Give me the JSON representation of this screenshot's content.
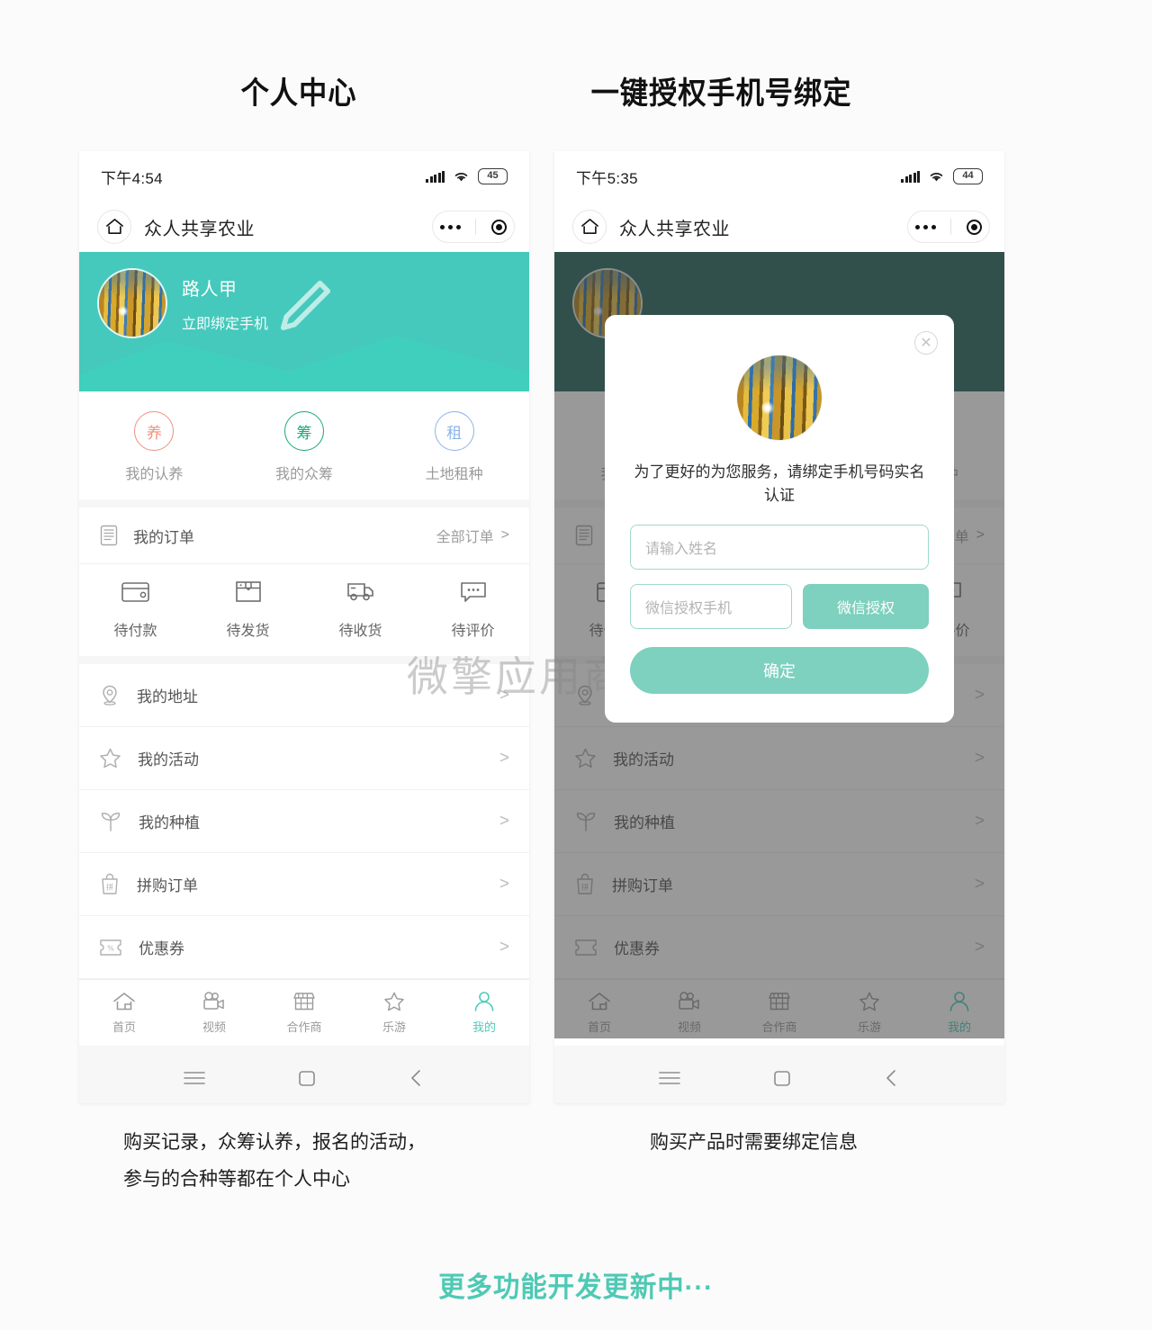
{
  "titles": {
    "left": "个人中心",
    "right": "一键授权手机号绑定"
  },
  "left_phone": {
    "status": {
      "time": "下午4:54",
      "battery": "45"
    },
    "nav": {
      "title": "众人共享农业",
      "home_icon": "home-icon",
      "more_icon": "more-dots-icon",
      "target_icon": "target-icon"
    },
    "profile": {
      "name": "路人甲",
      "subtitle": "立即绑定手机",
      "edit_icon": "pencil-icon"
    },
    "categories": [
      {
        "badge": "养",
        "label": "我的认养",
        "color": "#f0907c"
      },
      {
        "badge": "筹",
        "label": "我的众筹",
        "color": "#17a87e"
      },
      {
        "badge": "租",
        "label": "土地租种",
        "color": "#8cb4e6"
      }
    ],
    "orders": {
      "icon": "order-list-icon",
      "title": "我的订单",
      "all_label": "全部订单",
      "chevron": ">"
    },
    "statuses": [
      {
        "icon": "wallet-icon",
        "label": "待付款"
      },
      {
        "icon": "package-icon",
        "label": "待发货"
      },
      {
        "icon": "truck-icon",
        "label": "待收货"
      },
      {
        "icon": "comment-icon",
        "label": "待评价"
      }
    ],
    "menu": [
      {
        "icon": "location-pin-icon",
        "label": "我的地址",
        "chevron": ">"
      },
      {
        "icon": "star-icon",
        "label": "我的活动",
        "chevron": ">"
      },
      {
        "icon": "sprout-icon",
        "label": "我的种植",
        "chevron": ">"
      },
      {
        "icon": "group-buy-bag-icon",
        "label": "拼购订单",
        "chevron": ">"
      },
      {
        "icon": "coupon-icon",
        "label": "优惠券",
        "chevron": ">"
      }
    ],
    "tabs": [
      {
        "icon": "home-outline-icon",
        "label": "首页",
        "active": false
      },
      {
        "icon": "video-camera-icon",
        "label": "视频",
        "active": false
      },
      {
        "icon": "shop-icon",
        "label": "合作商",
        "active": false
      },
      {
        "icon": "star-outline-icon",
        "label": "乐游",
        "active": false
      },
      {
        "icon": "user-icon",
        "label": "我的",
        "active": true
      }
    ],
    "system_nav": [
      "menu-lines-icon",
      "square-icon",
      "back-chevron-icon"
    ]
  },
  "right_phone": {
    "status": {
      "time": "下午5:35",
      "battery": "44"
    },
    "nav": {
      "title": "众人共享农业"
    },
    "modal": {
      "close_icon": "close-circle-icon",
      "avatar_icon": "avatar-image",
      "message": "为了更好的为您服务，请绑定手机号码实名认证",
      "name_placeholder": "请输入姓名",
      "phone_placeholder": "微信授权手机",
      "auth_button": "微信授权",
      "confirm_button": "确定"
    }
  },
  "watermark": "微擎应用商城",
  "captions": {
    "left": "购买记录，众筹认养，报名的活动，\n参与的合种等都在个人中心",
    "right": "购买产品时需要绑定信息"
  },
  "footer": "更多功能开发更新中···",
  "colors": {
    "teal": "#45c9bc",
    "dark_teal": "#29665c",
    "mint_button": "#7ed0bf",
    "accent": "#4ec9b4"
  }
}
